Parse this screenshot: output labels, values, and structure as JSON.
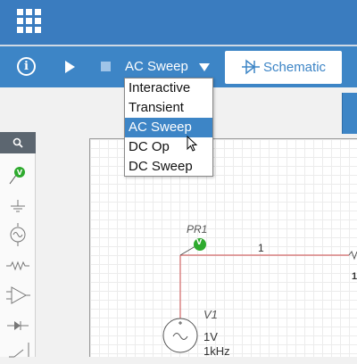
{
  "toolbar": {
    "simulation_mode": "AC Sweep",
    "schematic_button": "Schematic"
  },
  "sim_menu": {
    "items": [
      "Interactive",
      "Transient",
      "AC Sweep",
      "DC Op",
      "DC Sweep"
    ],
    "selected": "AC Sweep"
  },
  "palette": {
    "icons": [
      "search-icon",
      "voltage-probe-icon",
      "ground-icon",
      "ac-source-icon",
      "resistor-icon",
      "opamp-icon",
      "diode-icon",
      "switch-icon"
    ]
  },
  "canvas": {
    "probe_label": "PR1",
    "probe_marker": "V",
    "wire_label": "1",
    "source_name": "V1",
    "source_amplitude": "1V",
    "source_frequency": "1kHz",
    "edge_label": "1"
  },
  "colors": {
    "topbar": "#3a7cbf",
    "toolbar": "#3d85c6",
    "selection": "#3d85c6",
    "probe": "#2eaa2e",
    "wire": "#d46a6a"
  }
}
